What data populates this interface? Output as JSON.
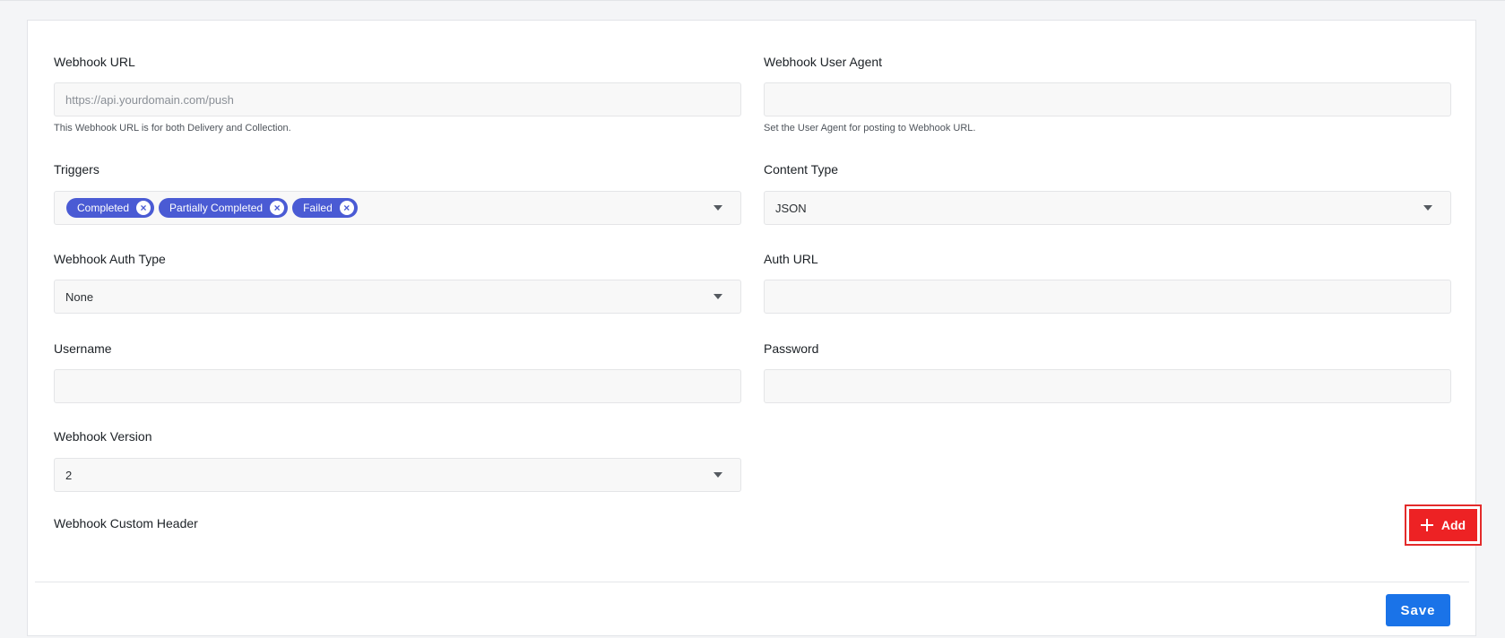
{
  "form": {
    "webhook_url": {
      "label": "Webhook URL",
      "placeholder": "https://api.yourdomain.com/push",
      "value": "",
      "help": "This Webhook URL is for both Delivery and Collection."
    },
    "webhook_user_agent": {
      "label": "Webhook User Agent",
      "value": "",
      "help": "Set the User Agent for posting to Webhook URL."
    },
    "triggers": {
      "label": "Triggers",
      "chips": [
        "Completed",
        "Partially Completed",
        "Failed"
      ]
    },
    "content_type": {
      "label": "Content Type",
      "value": "JSON"
    },
    "webhook_auth_type": {
      "label": "Webhook Auth Type",
      "value": "None"
    },
    "auth_url": {
      "label": "Auth URL",
      "value": ""
    },
    "username": {
      "label": "Username",
      "value": ""
    },
    "password": {
      "label": "Password",
      "value": ""
    },
    "webhook_version": {
      "label": "Webhook Version",
      "value": "2"
    },
    "custom_header": {
      "label": "Webhook Custom Header"
    }
  },
  "actions": {
    "add_label": "Add",
    "save_label": "Save"
  },
  "icons": {
    "chip_remove": "close-circle-icon",
    "dropdown": "chevron-down-icon",
    "add": "plus-icon"
  },
  "colors": {
    "chip": "#4a5bd4",
    "add_button": "#ed2224",
    "save_button": "#1a73e8"
  }
}
